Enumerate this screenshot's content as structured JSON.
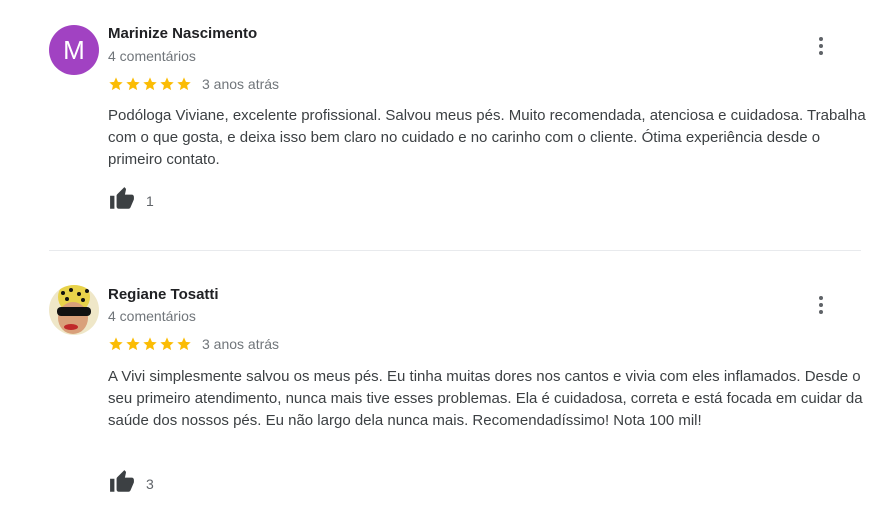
{
  "reviews": [
    {
      "avatar_letter": "M",
      "avatar_color": "#a142c2",
      "name": "Marinize Nascimento",
      "comments": "4 comentários",
      "rating": 5,
      "date": "3 anos atrás",
      "text": "Podóloga Viviane, excelente profissional. Salvou meus pés. Muito recomendada, atenciosa e cuidadosa. Trabalha com o que gosta, e deixa isso bem claro no cuidado e no carinho com o cliente. Ótima experiência desde o primeiro contato.",
      "likes": "1"
    },
    {
      "avatar_letter": "",
      "name": "Regiane Tosatti",
      "comments": "4 comentários",
      "rating": 5,
      "date": "3 anos atrás",
      "text": "A Vivi simplesmente salvou os meus pés. Eu tinha muitas dores nos cantos e vivia com eles inflamados. Desde o seu primeiro atendimento, nunca mais tive esses problemas. Ela é cuidadosa, correta e está focada em cuidar da saúde dos nossos pés. Eu não largo dela nunca mais. Recomendadíssimo! Nota 100 mil!",
      "likes": "3"
    }
  ],
  "colors": {
    "star": "#fbbc04",
    "avatar_purple": "#a142c2"
  },
  "icons": {
    "like": "thumbs-up-icon",
    "more": "more-vert-icon",
    "star": "star-icon"
  }
}
